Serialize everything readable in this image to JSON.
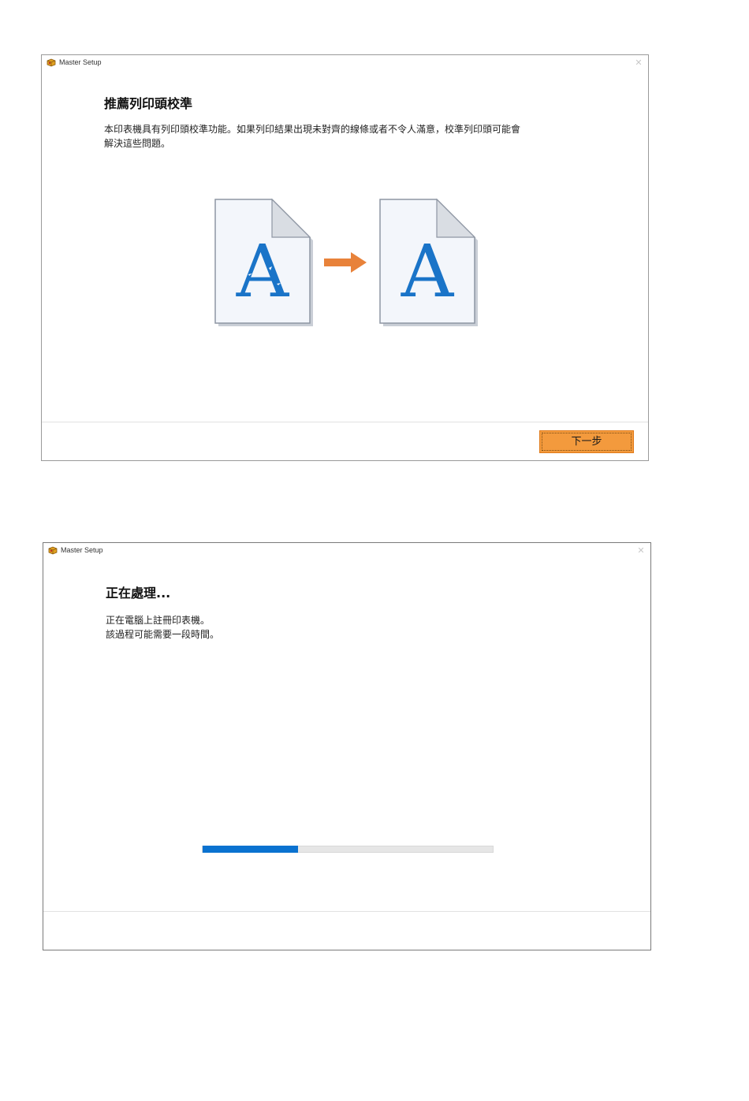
{
  "windows": [
    {
      "app_title": "Master Setup",
      "heading": "推薦列印頭校準",
      "body_lines": [
        "本印表機具有列印頭校準功能。如果列印結果出現未對齊的線條或者不令人滿意，校準列印頭可能會",
        "解決這些問題。"
      ],
      "illustration": {
        "before_letter": "A",
        "after_letter": "A",
        "arrow_color": "#e8823a",
        "letter_color": "#1a74c8"
      },
      "next_button_label": "下一步",
      "close_icon": "close-icon"
    },
    {
      "app_title": "Master Setup",
      "heading": "正在處理...",
      "body_lines": [
        "正在電腦上註冊印表機。",
        "該過程可能需要一段時間。"
      ],
      "progress_fraction": 0.33,
      "progress_color": "#0a72d0",
      "close_icon": "close-icon"
    }
  ]
}
